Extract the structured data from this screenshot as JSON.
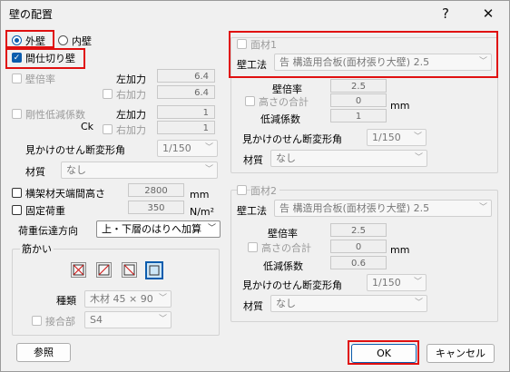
{
  "window": {
    "title": "壁の配置",
    "help_glyph": "?",
    "close_glyph": "✕"
  },
  "wall_type": {
    "outer": "外壁",
    "inner": "内壁",
    "partition": "間仕切り壁"
  },
  "left": {
    "wall_ratio": "壁倍率",
    "left_force": "左加力",
    "left_force_value": "6.4",
    "right_force": "右加力",
    "right_force_value": "6.4",
    "stiffness": "剛性低減係数",
    "ck": "Ck",
    "stiff_left": "左加力",
    "stiff_left_value": "1",
    "stiff_right": "右加力",
    "stiff_right_value": "1",
    "shear_angle": "見かけのせん断変形角",
    "shear_angle_value": "1/150",
    "material": "材質",
    "material_value": "なし",
    "frame_height": "横架材天端間高さ",
    "frame_height_value": "2800",
    "frame_height_unit": "mm",
    "fixed_load": "固定荷重",
    "fixed_load_value": "350",
    "fixed_load_unit": "N/m²",
    "load_path": "荷重伝達方向",
    "load_path_value": "上・下層のはりへ加算",
    "brace_group": "筋かい",
    "brace_kind": "種類",
    "brace_kind_value": "木材 45 × 90",
    "joint": "接合部",
    "joint_value": "S4",
    "ref_button": "参照"
  },
  "panel1": {
    "title": "面材1",
    "method": "壁工法",
    "method_value": "告 構造用合板(面材張り大壁) 2.5",
    "ratio": "壁倍率",
    "ratio_value": "2.5",
    "height_sum": "高さの合計",
    "height_sum_value": "0",
    "height_unit": "mm",
    "reduction": "低減係数",
    "reduction_value": "1",
    "shear_angle": "見かけのせん断変形角",
    "shear_angle_value": "1/150",
    "material": "材質",
    "material_value": "なし"
  },
  "panel2": {
    "title": "面材2",
    "method": "壁工法",
    "method_value": "告 構造用合板(面材張り大壁) 2.5",
    "ratio": "壁倍率",
    "ratio_value": "2.5",
    "height_sum": "高さの合計",
    "height_sum_value": "0",
    "height_unit": "mm",
    "reduction": "低減係数",
    "reduction_value": "0.6",
    "shear_angle": "見かけのせん断変形角",
    "shear_angle_value": "1/150",
    "material": "材質",
    "material_value": "なし"
  },
  "footer": {
    "ok": "OK",
    "cancel": "キャンセル"
  },
  "colors": {
    "accent": "#0b5cad",
    "highlight": "#e01010"
  }
}
